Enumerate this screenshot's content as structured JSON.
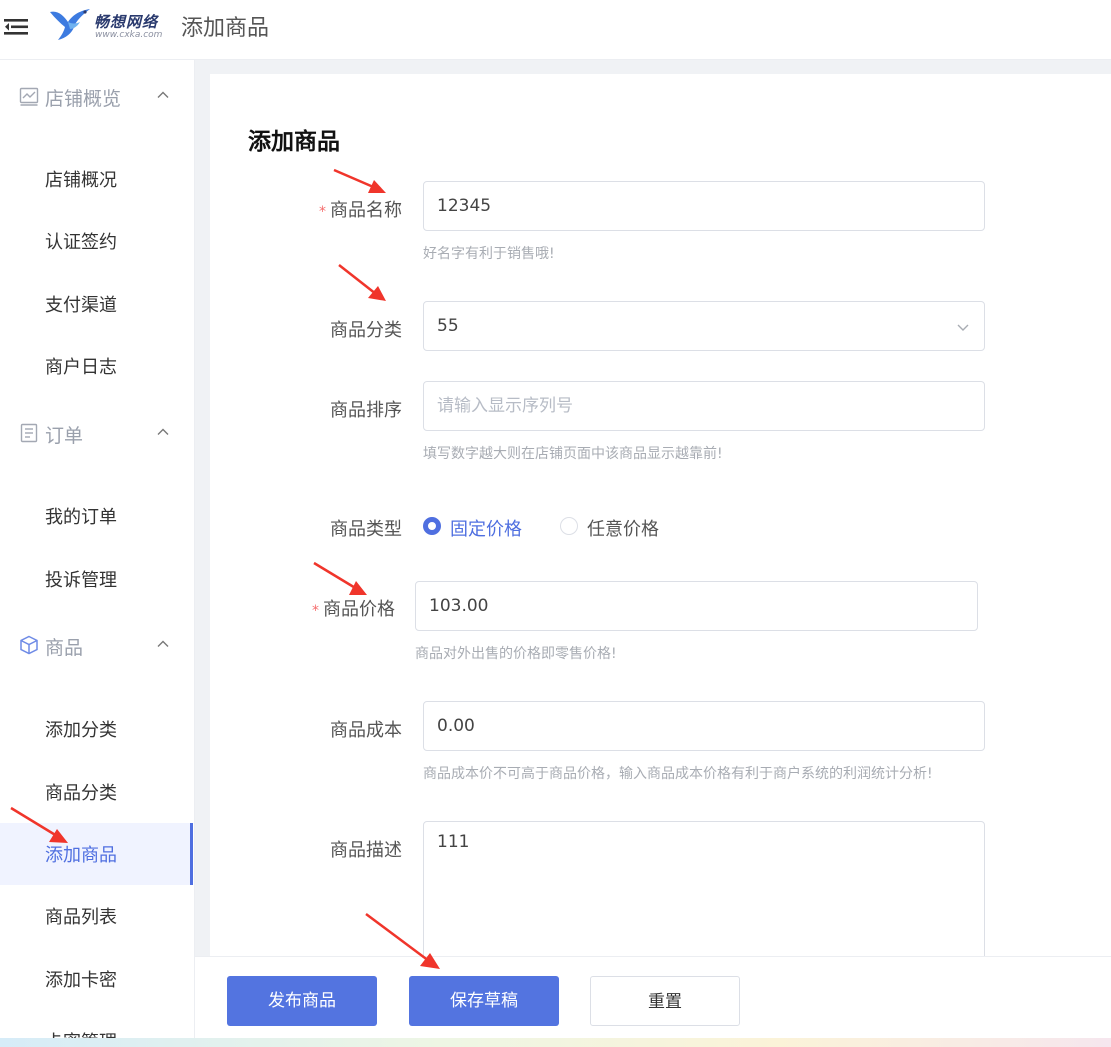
{
  "header": {
    "menu_icon": "menu-fold-icon",
    "logo_text": "畅想网络",
    "logo_url": "www.cxka.com",
    "page_title": "添加商品"
  },
  "sidebar": {
    "groups": [
      {
        "label": "店铺概览",
        "icon": "chart-icon",
        "items": [
          "店铺概况",
          "认证签约",
          "支付渠道",
          "商户日志"
        ]
      },
      {
        "label": "订单",
        "icon": "document-icon",
        "items": [
          "我的订单",
          "投诉管理"
        ]
      },
      {
        "label": "商品",
        "icon": "cube-icon",
        "items": [
          "添加分类",
          "商品分类",
          "添加商品",
          "商品列表",
          "添加卡密",
          "卡密管理"
        ]
      }
    ],
    "active_item": "添加商品"
  },
  "form": {
    "title": "添加商品",
    "name": {
      "label": "商品名称",
      "value": "12345",
      "hint": "好名字有利于销售哦!",
      "required_mark": "*"
    },
    "category": {
      "label": "商品分类",
      "value": "55"
    },
    "sort": {
      "label": "商品排序",
      "placeholder": "请输入显示序列号",
      "hint": "填写数字越大则在店铺页面中该商品显示越靠前!"
    },
    "type": {
      "label": "商品类型",
      "options": [
        "固定价格",
        "任意价格"
      ],
      "selected": "固定价格"
    },
    "price": {
      "label": "商品价格",
      "value": "103.00",
      "hint": "商品对外出售的价格即零售价格!",
      "required_mark": "*"
    },
    "cost": {
      "label": "商品成本",
      "value": "0.00",
      "hint": "商品成本价不可高于商品价格，输入商品成本价格有利于商户系统的利润统计分析!"
    },
    "description": {
      "label": "商品描述",
      "value": "111"
    }
  },
  "actions": {
    "publish": "发布商品",
    "save_draft": "保存草稿",
    "reset": "重置"
  },
  "colors": {
    "accent": "#4f6fe0",
    "button": "#5374e0",
    "required": "#f56c6c",
    "annotation_arrow": "#f0352b"
  }
}
